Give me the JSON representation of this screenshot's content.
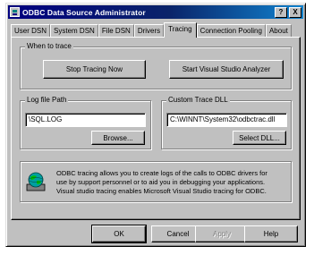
{
  "window": {
    "title": "ODBC Data Source Administrator",
    "help_button": "?",
    "close_button": "X"
  },
  "tabs": [
    "User DSN",
    "System DSN",
    "File DSN",
    "Drivers",
    "Tracing",
    "Connection Pooling",
    "About"
  ],
  "active_tab": "Tracing",
  "when_to_trace": {
    "label": "When to trace",
    "stop_button": "Stop Tracing Now",
    "vs_button": "Start Visual Studio Analyzer"
  },
  "log_file": {
    "label": "Log file Path",
    "value": "\\SQL.LOG",
    "browse_button": "Browse..."
  },
  "custom_dll": {
    "label": "Custom Trace DLL",
    "value": "C:\\WINNT\\System32\\odbctrac.dll",
    "select_button": "Select DLL..."
  },
  "info": {
    "icon": "odbc-globe-icon",
    "lines": [
      "ODBC tracing allows you to create logs of the calls to ODBC drivers for",
      "use by support personnel or to aid you in debugging your applications.",
      "Visual studio tracing enables Microsoft Visual Studio tracing for ODBC."
    ]
  },
  "buttons": {
    "ok": "OK",
    "cancel": "Cancel",
    "apply": "Apply",
    "help": "Help"
  },
  "colors": {
    "title_active": "#000080",
    "face": "#c0c0c0"
  }
}
